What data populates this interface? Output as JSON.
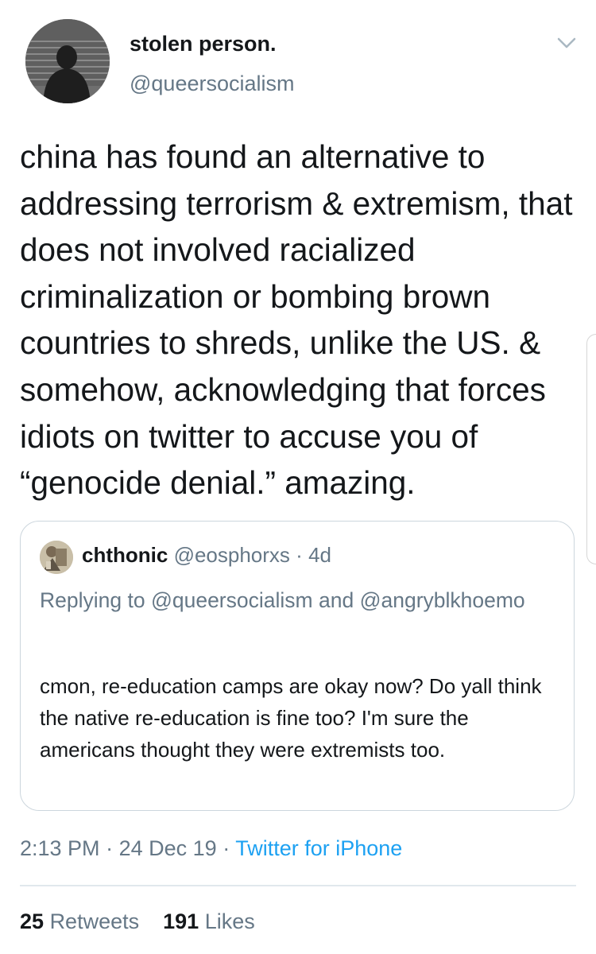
{
  "tweet": {
    "author": {
      "display_name": "stolen person.",
      "handle": "@queersocialism",
      "avatar_icon": "avatar-silhouette-window"
    },
    "menu_icon": "chevron-down-icon",
    "text": "china has found an alternative to addressing terrorism & extremism, that does not involved racialized criminalization or bombing brown countries to shreds, unlike the US. & somehow, acknowledging that forces idiots on twitter to accuse you of “genocide denial.” amazing.",
    "quoted": {
      "author_name": "chthonic",
      "handle": "@eosphorxs",
      "separator": "·",
      "age": "4d",
      "replying_prefix": "Replying to",
      "replying_mention_1": "@queersocialism",
      "replying_and": "and",
      "replying_mention_2": "@angryblkhoemo",
      "text": "cmon, re-education camps are okay now? Do yall think the native re-education is fine too? I'm sure the americans thought they were extremists too."
    },
    "time": "2:13 PM",
    "date": "24 Dec 19",
    "separator": "·",
    "source": "Twitter for iPhone",
    "retweets_count": "25",
    "retweets_label": "Retweets",
    "likes_count": "191",
    "likes_label": "Likes"
  },
  "colors": {
    "text_primary": "#14171a",
    "text_secondary": "#657786",
    "link": "#1da1f2",
    "border": "#ccd6dd"
  }
}
